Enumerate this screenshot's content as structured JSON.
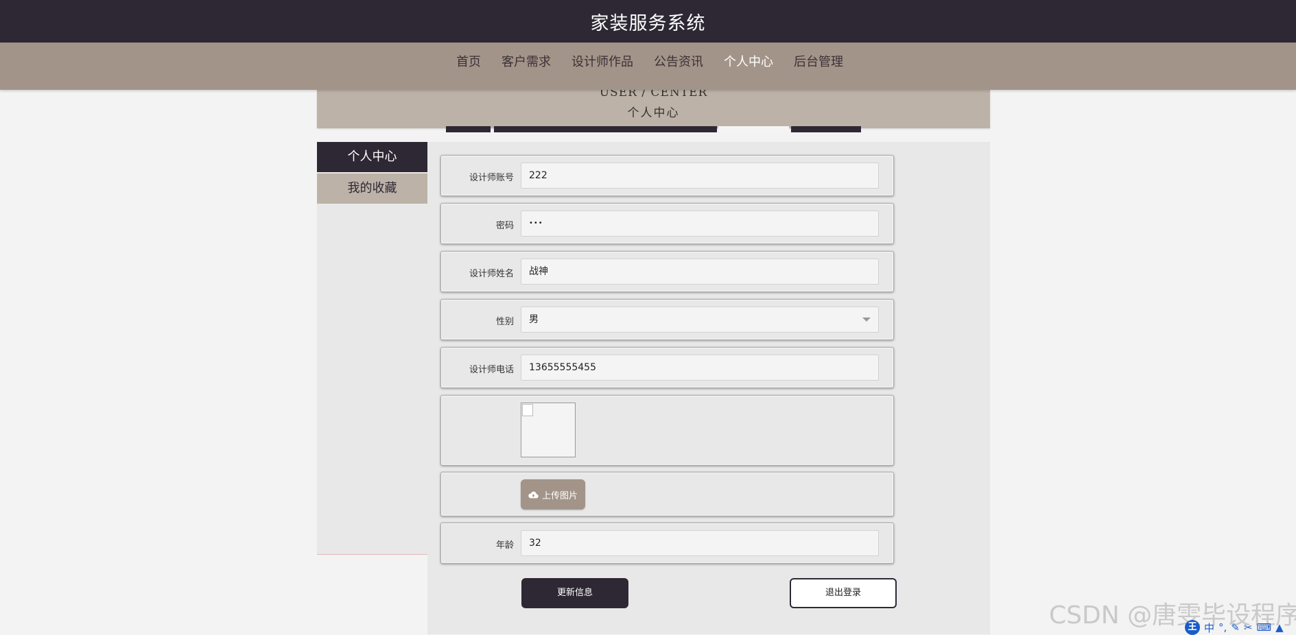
{
  "header": {
    "title": "家装服务系统"
  },
  "nav": {
    "items": [
      "首页",
      "客户需求",
      "设计师作品",
      "公告资讯",
      "个人中心",
      "后台管理"
    ],
    "active_index": 4
  },
  "banner": {
    "en": "USER / CENTER",
    "cn": "个人中心"
  },
  "sidebar": {
    "items": [
      "个人中心",
      "我的收藏"
    ]
  },
  "form": {
    "account": {
      "label": "设计师账号",
      "value": "222"
    },
    "password": {
      "label": "密码",
      "value": "•••"
    },
    "name": {
      "label": "设计师姓名",
      "value": "战神"
    },
    "gender": {
      "label": "性别",
      "value": "男"
    },
    "phone": {
      "label": "设计师电话",
      "value": "13655555455"
    },
    "upload_label": "上传图片",
    "age": {
      "label": "年龄",
      "value": "32"
    }
  },
  "buttons": {
    "update": "更新信息",
    "logout": "退出登录"
  },
  "watermark": "CSDN @唐雯毕设程序",
  "ime": {
    "mode": "中"
  },
  "colors": {
    "dark": "#2e2834",
    "tan": "#a39489",
    "beige": "#bdb2a7",
    "bg": "#e8e8e8"
  }
}
